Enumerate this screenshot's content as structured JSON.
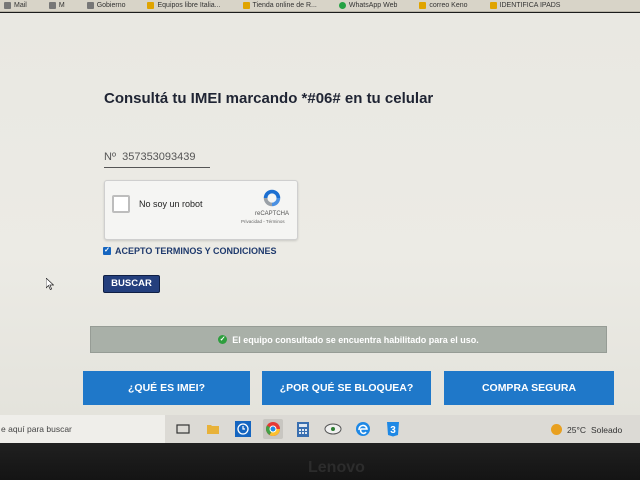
{
  "bookmarks": [
    {
      "label": "Mail",
      "icon": "mail-icon"
    },
    {
      "label": "M",
      "icon": "gmail-icon"
    },
    {
      "label": "Gobierno",
      "icon": "bookmark-icon"
    },
    {
      "label": "Equipos libre Italia...",
      "icon": "folder-icon"
    },
    {
      "label": "Tienda online de R...",
      "icon": "folder-icon"
    },
    {
      "label": "WhatsApp Web",
      "icon": "whatsapp-icon"
    },
    {
      "label": "correo Keno",
      "icon": "folder-icon"
    },
    {
      "label": "IDENTIFICA IPADS",
      "icon": "folder-icon"
    }
  ],
  "page": {
    "title": "Consultá tu IMEI marcando *#06# en tu celular",
    "imei_prefix": "Nº",
    "imei_value": "357353093439",
    "recaptcha": {
      "label": "No soy un robot",
      "brand": "reCAPTCHA",
      "links": "Privacidad - Términos"
    },
    "terms_label": "ACEPTO TERMINOS Y CONDICIONES",
    "terms_checked": true,
    "search_button": "BUSCAR",
    "status_message": "El equipo consultado se encuentra habilitado para el uso.",
    "buttons": [
      "¿QUÉ ES IMEI?",
      "¿POR QUÉ SE BLOQUEA?",
      "COMPRA SEGURA"
    ]
  },
  "colors": {
    "title": "#1f2433",
    "button_blue": "#1f78c9",
    "search_button": "#243f7d",
    "status_bar": "#a9b0a8",
    "status_ok": "#2e9e3e"
  },
  "taskbar": {
    "search_placeholder": "e aquí para buscar",
    "icons": [
      "task-view-icon",
      "folder-icon",
      "clock-app-icon",
      "chrome-icon",
      "calculator-icon",
      "network-icon",
      "edge-icon",
      "app-3-icon"
    ],
    "weather_temp": "25°C",
    "weather_text": "Soleado"
  },
  "device_brand": "Lenovo"
}
